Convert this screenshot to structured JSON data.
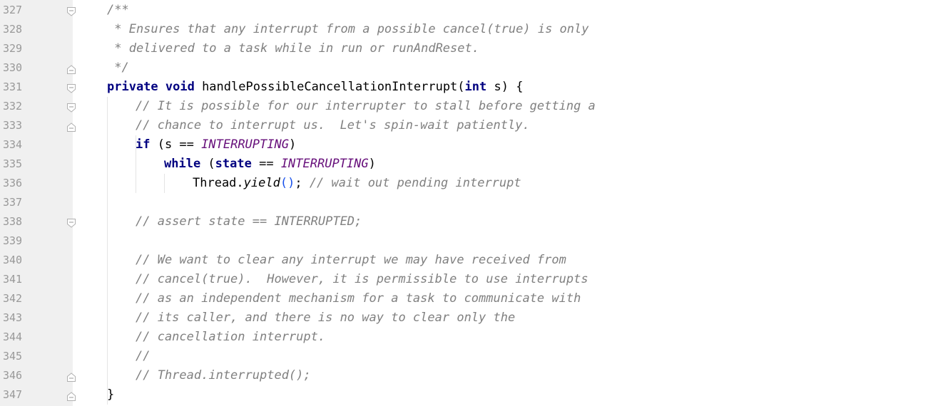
{
  "editor": {
    "lines": [
      {
        "num": "327",
        "fold": "start",
        "indent": 0,
        "segments": [
          {
            "t": "/**",
            "c": "cmt"
          }
        ]
      },
      {
        "num": "328",
        "fold": "",
        "indent": 0,
        "segments": [
          {
            "t": " * Ensures that any interrupt from a possible cancel(true) is only",
            "c": "cmt"
          }
        ]
      },
      {
        "num": "329",
        "fold": "",
        "indent": 0,
        "segments": [
          {
            "t": " * delivered to a task while in run or runAndReset.",
            "c": "cmt"
          }
        ]
      },
      {
        "num": "330",
        "fold": "end",
        "indent": 0,
        "segments": [
          {
            "t": " */",
            "c": "cmt"
          }
        ]
      },
      {
        "num": "331",
        "fold": "start",
        "indent": 0,
        "segments": [
          {
            "t": "private void",
            "c": "kw"
          },
          {
            "t": " handlePossibleCancellationInterrupt(",
            "c": ""
          },
          {
            "t": "int",
            "c": "kw"
          },
          {
            "t": " s) {",
            "c": ""
          }
        ]
      },
      {
        "num": "332",
        "fold": "start",
        "indent": 1,
        "segments": [
          {
            "t": "// It is possible for our interrupter to stall before getting a",
            "c": "cmt"
          }
        ]
      },
      {
        "num": "333",
        "fold": "end",
        "indent": 1,
        "segments": [
          {
            "t": "// chance to interrupt us.  Let's spin-wait patiently.",
            "c": "cmt"
          }
        ]
      },
      {
        "num": "334",
        "fold": "",
        "indent": 1,
        "segments": [
          {
            "t": "if",
            "c": "kw"
          },
          {
            "t": " (s == ",
            "c": ""
          },
          {
            "t": "INTERRUPTING",
            "c": "const"
          },
          {
            "t": ")",
            "c": ""
          }
        ]
      },
      {
        "num": "335",
        "fold": "",
        "indent": 2,
        "segments": [
          {
            "t": "while",
            "c": "kw"
          },
          {
            "t": " (",
            "c": ""
          },
          {
            "t": "state",
            "c": "kw"
          },
          {
            "t": " == ",
            "c": ""
          },
          {
            "t": "INTERRUPTING",
            "c": "const"
          },
          {
            "t": ")",
            "c": ""
          }
        ]
      },
      {
        "num": "336",
        "fold": "",
        "indent": 3,
        "segments": [
          {
            "t": "Thread.",
            "c": ""
          },
          {
            "t": "yield",
            "c": "method"
          },
          {
            "t": "()",
            "c": "paren"
          },
          {
            "t": "; ",
            "c": ""
          },
          {
            "t": "// wait out pending interrupt",
            "c": "cmt"
          }
        ]
      },
      {
        "num": "337",
        "fold": "",
        "indent": 0,
        "segments": []
      },
      {
        "num": "338",
        "fold": "single",
        "indent": 1,
        "segments": [
          {
            "t": "// assert state == INTERRUPTED;",
            "c": "cmt"
          }
        ]
      },
      {
        "num": "339",
        "fold": "",
        "indent": 0,
        "segments": []
      },
      {
        "num": "340",
        "fold": "",
        "indent": 1,
        "segments": [
          {
            "t": "// We want to clear any interrupt we may have received from",
            "c": "cmt"
          }
        ]
      },
      {
        "num": "341",
        "fold": "",
        "indent": 1,
        "segments": [
          {
            "t": "// cancel(true).  However, it is permissible to use interrupts",
            "c": "cmt"
          }
        ]
      },
      {
        "num": "342",
        "fold": "",
        "indent": 1,
        "segments": [
          {
            "t": "// as an independent mechanism for a task to communicate with",
            "c": "cmt"
          }
        ]
      },
      {
        "num": "343",
        "fold": "",
        "indent": 1,
        "segments": [
          {
            "t": "// its caller, and there is no way to clear only the",
            "c": "cmt"
          }
        ]
      },
      {
        "num": "344",
        "fold": "",
        "indent": 1,
        "segments": [
          {
            "t": "// cancellation interrupt.",
            "c": "cmt"
          }
        ]
      },
      {
        "num": "345",
        "fold": "",
        "indent": 1,
        "segments": [
          {
            "t": "//",
            "c": "cmt"
          }
        ]
      },
      {
        "num": "346",
        "fold": "end",
        "indent": 1,
        "segments": [
          {
            "t": "// Thread.interrupted();",
            "c": "cmt"
          }
        ]
      },
      {
        "num": "347",
        "fold": "end",
        "indent": 0,
        "segments": [
          {
            "t": "}",
            "c": ""
          }
        ]
      }
    ]
  }
}
